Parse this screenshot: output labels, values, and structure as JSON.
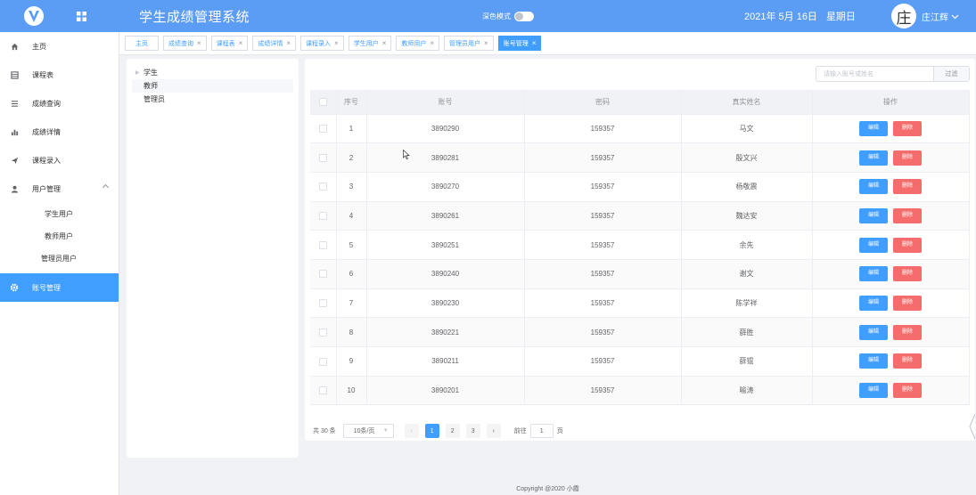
{
  "header": {
    "title": "学生成绩管理系统",
    "dark_mode_label": "深色模式",
    "date": "2021年 5月 16日",
    "weekday": "星期日",
    "avatar_char": "庄",
    "username": "庄江辉"
  },
  "sidebar": {
    "items": [
      {
        "label": "主页",
        "icon": "home-icon"
      },
      {
        "label": "课程表",
        "icon": "calendar-icon"
      },
      {
        "label": "成绩查询",
        "icon": "list-icon"
      },
      {
        "label": "成绩详情",
        "icon": "bar-chart-icon"
      },
      {
        "label": "课程录入",
        "icon": "send-icon"
      },
      {
        "label": "用户管理",
        "icon": "user-icon"
      }
    ],
    "user_sub": [
      "学生用户",
      "教师用户",
      "管理员用户"
    ],
    "account": {
      "label": "账号管理",
      "icon": "gear-icon"
    }
  },
  "tabs": [
    "主页",
    "成绩查询",
    "课程表",
    "成绩详情",
    "课程录入",
    "学生用户",
    "教师用户",
    "管理员用户",
    "账号管理"
  ],
  "tree": [
    "学生",
    "教师",
    "管理员"
  ],
  "search": {
    "placeholder": "请输入账号或姓名",
    "button": "过滤"
  },
  "table": {
    "headers": [
      "序号",
      "账号",
      "密码",
      "真实姓名",
      "操作"
    ],
    "rows": [
      {
        "no": "1",
        "account": "3890290",
        "password": "159357",
        "name": "马文"
      },
      {
        "no": "2",
        "account": "3890281",
        "password": "159357",
        "name": "殷文兴"
      },
      {
        "no": "3",
        "account": "3890270",
        "password": "159357",
        "name": "杨敬震"
      },
      {
        "no": "4",
        "account": "3890261",
        "password": "159357",
        "name": "魏达安"
      },
      {
        "no": "5",
        "account": "3890251",
        "password": "159357",
        "name": "余先"
      },
      {
        "no": "6",
        "account": "3890240",
        "password": "159357",
        "name": "谢文"
      },
      {
        "no": "7",
        "account": "3890230",
        "password": "159357",
        "name": "陈学祥"
      },
      {
        "no": "8",
        "account": "3890221",
        "password": "159357",
        "name": "薛胜"
      },
      {
        "no": "9",
        "account": "3890211",
        "password": "159357",
        "name": "薛锟"
      },
      {
        "no": "10",
        "account": "3890201",
        "password": "159357",
        "name": "喻涛"
      }
    ],
    "edit_label": "编辑",
    "delete_label": "删除"
  },
  "pagination": {
    "total": "共 30 条",
    "page_size": "10条/页",
    "pages": [
      "1",
      "2",
      "3"
    ],
    "current": "1",
    "goto_label": "前往",
    "goto_value": "1",
    "page_unit": "页"
  },
  "footer": "Copyright @2020 小霞",
  "colors": {
    "header": "#5b9cf5",
    "primary": "#409eff",
    "danger": "#f56c6c"
  }
}
